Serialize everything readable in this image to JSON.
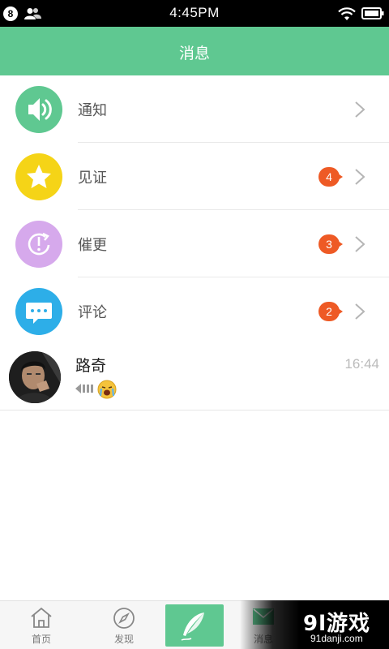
{
  "status_bar": {
    "notification_count": "8",
    "time": "4:45PM"
  },
  "header": {
    "title": "消息"
  },
  "categories": [
    {
      "label": "通知",
      "icon": "speaker-icon",
      "color": "#5fc891",
      "badge": ""
    },
    {
      "label": "见证",
      "icon": "star-icon",
      "color": "#f5d417",
      "badge": "4"
    },
    {
      "label": "催更",
      "icon": "exclamation-refresh-icon",
      "color": "#d6a9ec",
      "badge": "3"
    },
    {
      "label": "评论",
      "icon": "chat-bubble-icon",
      "color": "#2daee8",
      "badge": "2"
    }
  ],
  "messages": [
    {
      "name": "路奇",
      "time": "16:44",
      "preview_icons": [
        "voice-icon",
        "crying-emoji-icon"
      ]
    }
  ],
  "bottom_nav": {
    "items": [
      {
        "label": "首页",
        "icon": "home-icon"
      },
      {
        "label": "发现",
        "icon": "compass-icon"
      },
      {
        "label": "",
        "icon": "feather-icon"
      },
      {
        "label": "消息",
        "icon": "mail-icon"
      }
    ]
  },
  "watermark": {
    "logo": "9l游戏",
    "url": "91danji.com"
  },
  "colors": {
    "accent": "#5fc891",
    "badge": "#ee5a25"
  }
}
